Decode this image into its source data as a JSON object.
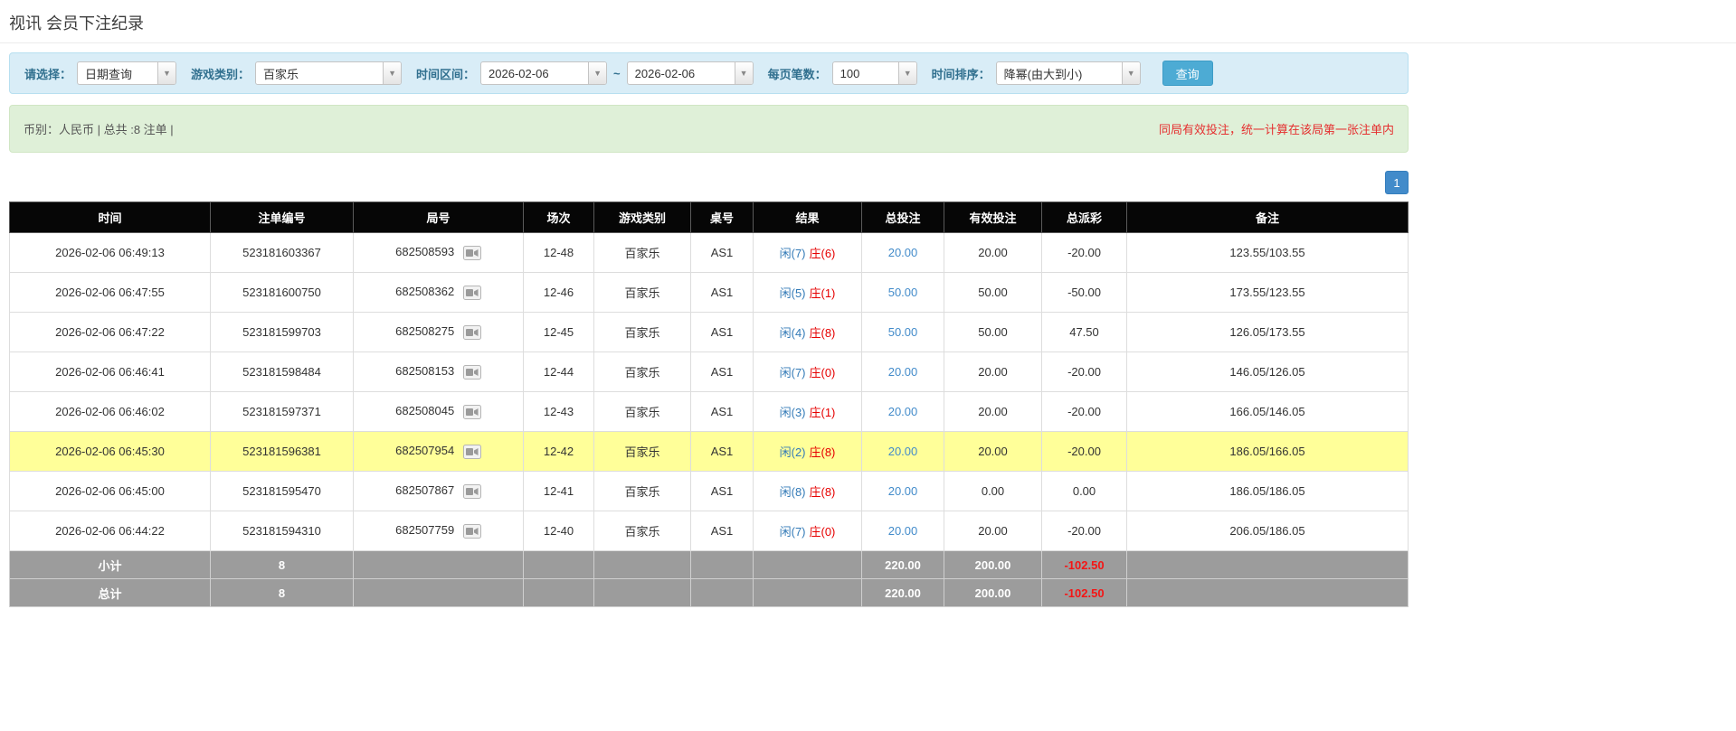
{
  "colors": {
    "accent_blue": "#428bca",
    "link_blue": "#337ab7",
    "negative_red": "#e60000",
    "highlight_yellow": "#ffff99",
    "filter_bar_bg": "#d9edf7",
    "info_bar_bg": "#dff0d8",
    "table_header_bg": "#060606",
    "summary_row_bg": "#9c9c9c"
  },
  "page": {
    "title": "视讯 会员下注纪录"
  },
  "filters": {
    "query_type": {
      "label": "请选择：",
      "value": "日期查询"
    },
    "game_type": {
      "label": "游戏类别：",
      "value": "百家乐"
    },
    "time_range": {
      "label": "时间区间：",
      "from": "2026-02-06",
      "separator": "~",
      "to": "2026-02-06"
    },
    "page_size": {
      "label": "每页笔数：",
      "value": "100"
    },
    "sort": {
      "label": "时间排序：",
      "value": "降幂(由大到小)"
    },
    "search_button": "查询"
  },
  "info_bar": {
    "left": "币别：人民币 | 总共 :8 注单 |",
    "right": "同局有效投注，统一计算在该局第一张注单内"
  },
  "pagination": {
    "current_page": "1"
  },
  "table": {
    "headers": [
      "时间",
      "注单编号",
      "局号",
      "场次",
      "游戏类别",
      "桌号",
      "结果",
      "总投注",
      "有效投注",
      "总派彩",
      "备注"
    ],
    "rows": [
      {
        "time": "2026-02-06 06:49:13",
        "bet_id": "523181603367",
        "round_id": "682508593",
        "session": "12-48",
        "game_type": "百家乐",
        "table_no": "AS1",
        "result_player": "闲(7)",
        "result_banker": "庄(6)",
        "total_bet": "20.00",
        "valid_bet": "20.00",
        "payout": "-20.00",
        "remark": "123.55/103.55",
        "highlighted": false
      },
      {
        "time": "2026-02-06 06:47:55",
        "bet_id": "523181600750",
        "round_id": "682508362",
        "session": "12-46",
        "game_type": "百家乐",
        "table_no": "AS1",
        "result_player": "闲(5)",
        "result_banker": "庄(1)",
        "total_bet": "50.00",
        "valid_bet": "50.00",
        "payout": "-50.00",
        "remark": "173.55/123.55",
        "highlighted": false
      },
      {
        "time": "2026-02-06 06:47:22",
        "bet_id": "523181599703",
        "round_id": "682508275",
        "session": "12-45",
        "game_type": "百家乐",
        "table_no": "AS1",
        "result_player": "闲(4)",
        "result_banker": "庄(8)",
        "total_bet": "50.00",
        "valid_bet": "50.00",
        "payout": "47.50",
        "remark": "126.05/173.55",
        "highlighted": false
      },
      {
        "time": "2026-02-06 06:46:41",
        "bet_id": "523181598484",
        "round_id": "682508153",
        "session": "12-44",
        "game_type": "百家乐",
        "table_no": "AS1",
        "result_player": "闲(7)",
        "result_banker": "庄(0)",
        "total_bet": "20.00",
        "valid_bet": "20.00",
        "payout": "-20.00",
        "remark": "146.05/126.05",
        "highlighted": false
      },
      {
        "time": "2026-02-06 06:46:02",
        "bet_id": "523181597371",
        "round_id": "682508045",
        "session": "12-43",
        "game_type": "百家乐",
        "table_no": "AS1",
        "result_player": "闲(3)",
        "result_banker": "庄(1)",
        "total_bet": "20.00",
        "valid_bet": "20.00",
        "payout": "-20.00",
        "remark": "166.05/146.05",
        "highlighted": false
      },
      {
        "time": "2026-02-06 06:45:30",
        "bet_id": "523181596381",
        "round_id": "682507954",
        "session": "12-42",
        "game_type": "百家乐",
        "table_no": "AS1",
        "result_player": "闲(2)",
        "result_banker": "庄(8)",
        "total_bet": "20.00",
        "valid_bet": "20.00",
        "payout": "-20.00",
        "remark": "186.05/166.05",
        "highlighted": true
      },
      {
        "time": "2026-02-06 06:45:00",
        "bet_id": "523181595470",
        "round_id": "682507867",
        "session": "12-41",
        "game_type": "百家乐",
        "table_no": "AS1",
        "result_player": "闲(8)",
        "result_banker": "庄(8)",
        "total_bet": "20.00",
        "valid_bet": "0.00",
        "payout": "0.00",
        "remark": "186.05/186.05",
        "highlighted": false
      },
      {
        "time": "2026-02-06 06:44:22",
        "bet_id": "523181594310",
        "round_id": "682507759",
        "session": "12-40",
        "game_type": "百家乐",
        "table_no": "AS1",
        "result_player": "闲(7)",
        "result_banker": "庄(0)",
        "total_bet": "20.00",
        "valid_bet": "20.00",
        "payout": "-20.00",
        "remark": "206.05/186.05",
        "highlighted": false
      }
    ],
    "footer": [
      {
        "label": "小计",
        "count": "8",
        "total_bet": "220.00",
        "valid_bet": "200.00",
        "payout": "-102.50"
      },
      {
        "label": "总计",
        "count": "8",
        "total_bet": "220.00",
        "valid_bet": "200.00",
        "payout": "-102.50"
      }
    ]
  }
}
